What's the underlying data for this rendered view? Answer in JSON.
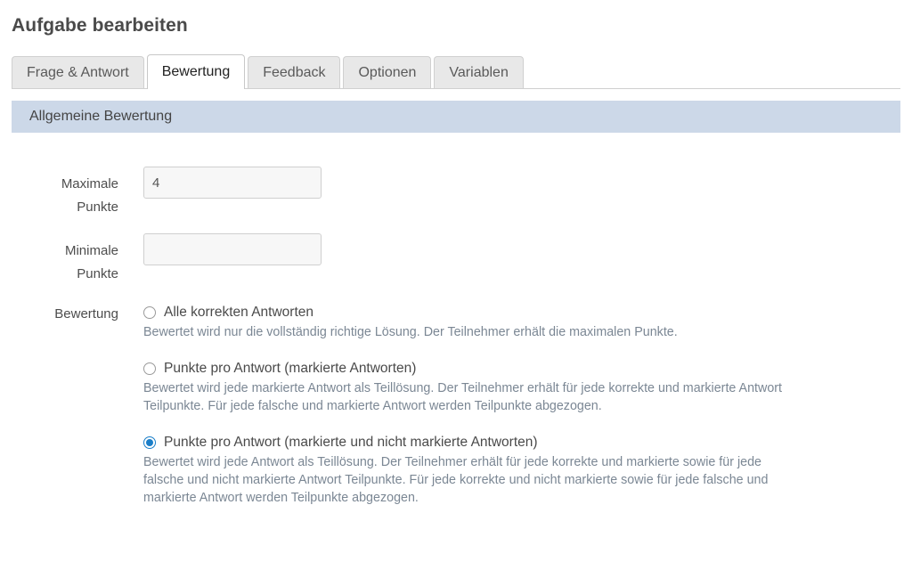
{
  "page": {
    "title": "Aufgabe bearbeiten"
  },
  "tabs": [
    {
      "label": "Frage & Antwort",
      "active": false
    },
    {
      "label": "Bewertung",
      "active": true
    },
    {
      "label": "Feedback",
      "active": false
    },
    {
      "label": "Optionen",
      "active": false
    },
    {
      "label": "Variablen",
      "active": false
    }
  ],
  "section": {
    "header": "Allgemeine Bewertung"
  },
  "fields": {
    "max_points": {
      "label_line1": "Maximale",
      "label_line2": "Punkte",
      "value": "4",
      "placeholder": ""
    },
    "min_points": {
      "label_line1": "Minimale",
      "label_line2": "Punkte",
      "value": "",
      "placeholder": ""
    }
  },
  "scoring": {
    "group_label": "Bewertung",
    "options": [
      {
        "title": "Alle korrekten Antworten",
        "description": "Bewertet wird nur die vollständig richtige Lösung. Der Teilnehmer erhält die maximalen Punkte.",
        "checked": false
      },
      {
        "title": "Punkte pro Antwort (markierte Antworten)",
        "description": "Bewertet wird jede markierte Antwort als Teillösung. Der Teilnehmer erhält für jede korrekte und markierte Antwort Teilpunkte. Für jede falsche und markierte Antwort werden Teilpunkte abgezogen.",
        "checked": false
      },
      {
        "title": "Punkte pro Antwort (markierte und nicht markierte Antworten)",
        "description": "Bewertet wird jede Antwort als Teillösung. Der Teilnehmer erhält für jede korrekte und markierte sowie für jede falsche und nicht markierte Antwort Teilpunkte. Für jede korrekte und nicht markierte sowie für jede falsche und markierte Antwort werden Teilpunkte abgezogen.",
        "checked": true
      }
    ]
  },
  "colors": {
    "accent": "#1a7ec8",
    "section_header_bg": "#ccd8e8",
    "title_text": "#4a4a4a",
    "description_text": "#7b8794"
  }
}
